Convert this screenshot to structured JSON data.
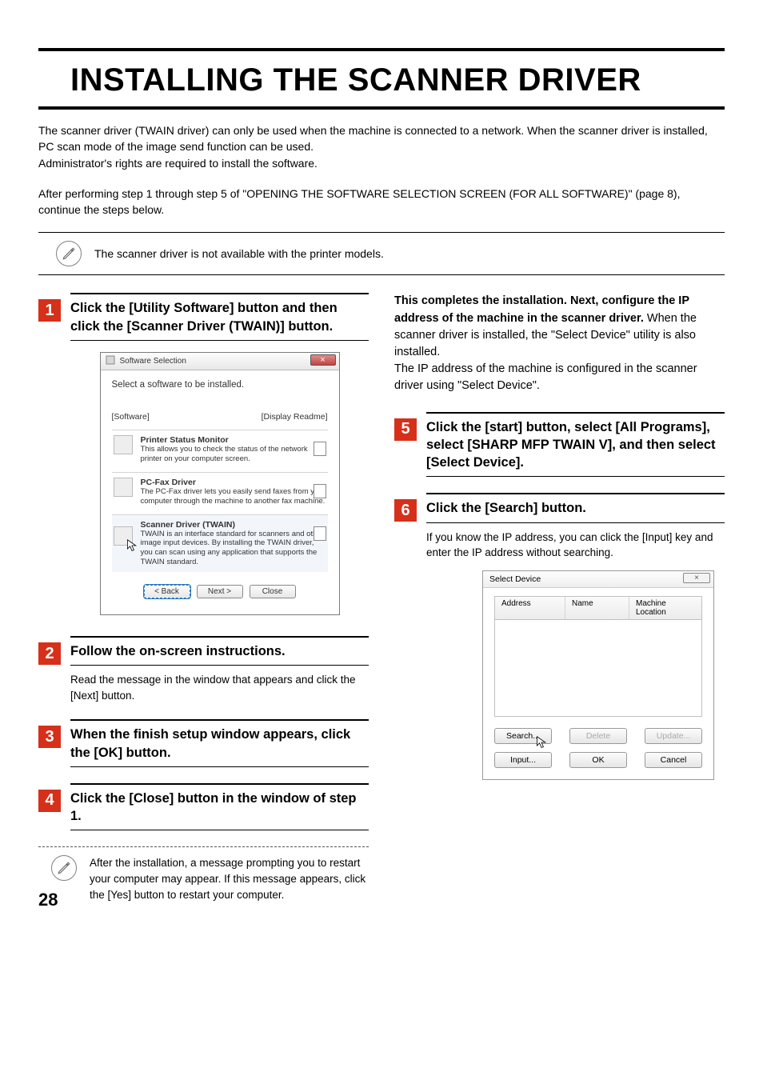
{
  "doc_title": "INSTALLING THE SCANNER DRIVER",
  "intro1": "The scanner driver (TWAIN driver) can only be used when the machine is connected to a network. When the scanner driver is installed, PC scan mode of the image send function can be used.",
  "intro2": "Administrator's rights are required to install the software.",
  "intro3": "After performing step 1 through step 5 of \"OPENING THE SOFTWARE SELECTION SCREEN (FOR ALL SOFTWARE)\" (page 8), continue the steps below.",
  "top_note": "The scanner driver is not available with the printer models.",
  "steps": {
    "s1": {
      "num": "1",
      "head": "Click the [Utility Software] button and then click the [Scanner Driver (TWAIN)] button."
    },
    "s2": {
      "num": "2",
      "head": "Follow the on-screen instructions.",
      "sub": "Read the message in the window that appears and click the [Next] button."
    },
    "s3": {
      "num": "3",
      "head": "When the finish setup window appears, click the [OK] button."
    },
    "s4": {
      "num": "4",
      "head": "Click the [Close] button in the window of step 1."
    },
    "s5": {
      "num": "5",
      "head": "Click the [start] button, select [All Programs], select [SHARP MFP TWAIN V], and then select [Select Device]."
    },
    "s6": {
      "num": "6",
      "head": "Click the [Search] button.",
      "sub": "If you know the IP address, you can click the [Input] key and enter the IP address without searching."
    }
  },
  "completion": {
    "bold": "This completes the installation. Next, configure the IP address of the machine in the scanner driver.",
    "p1": "When the scanner driver is installed, the \"Select Device\" utility is also installed.",
    "p2": "The IP address of the machine is configured in the scanner driver using \"Select Device\"."
  },
  "tip_after_4": "After the installation, a message prompting you to restart your computer may appear. If this message appears, click the [Yes] button to restart your computer.",
  "ss_window": {
    "title": "Software Selection",
    "heading": "Select a software to be installed.",
    "labels": {
      "left": "[Software]",
      "right": "[Display Readme]"
    },
    "items": [
      {
        "ttl": "Printer Status Monitor",
        "dsc": "This allows you to check the status of the network printer on your computer screen."
      },
      {
        "ttl": "PC-Fax Driver",
        "dsc": "The PC-Fax driver lets you easily send faxes from your computer through the machine to another fax machine."
      },
      {
        "ttl": "Scanner Driver (TWAIN)",
        "dsc": "TWAIN is an interface standard for scanners and other image input devices. By installing the TWAIN driver, you can scan using any application that supports the TWAIN standard."
      }
    ],
    "buttons": {
      "back": "< Back",
      "next": "Next >",
      "close": "Close"
    }
  },
  "sd_window": {
    "title": "Select Device",
    "cols": {
      "addr": "Address",
      "name": "Name",
      "loc": "Machine Location"
    },
    "buttons": {
      "search": "Search...",
      "delete": "Delete",
      "update": "Update...",
      "input": "Input...",
      "ok": "OK",
      "cancel": "Cancel"
    }
  },
  "page_number": "28"
}
